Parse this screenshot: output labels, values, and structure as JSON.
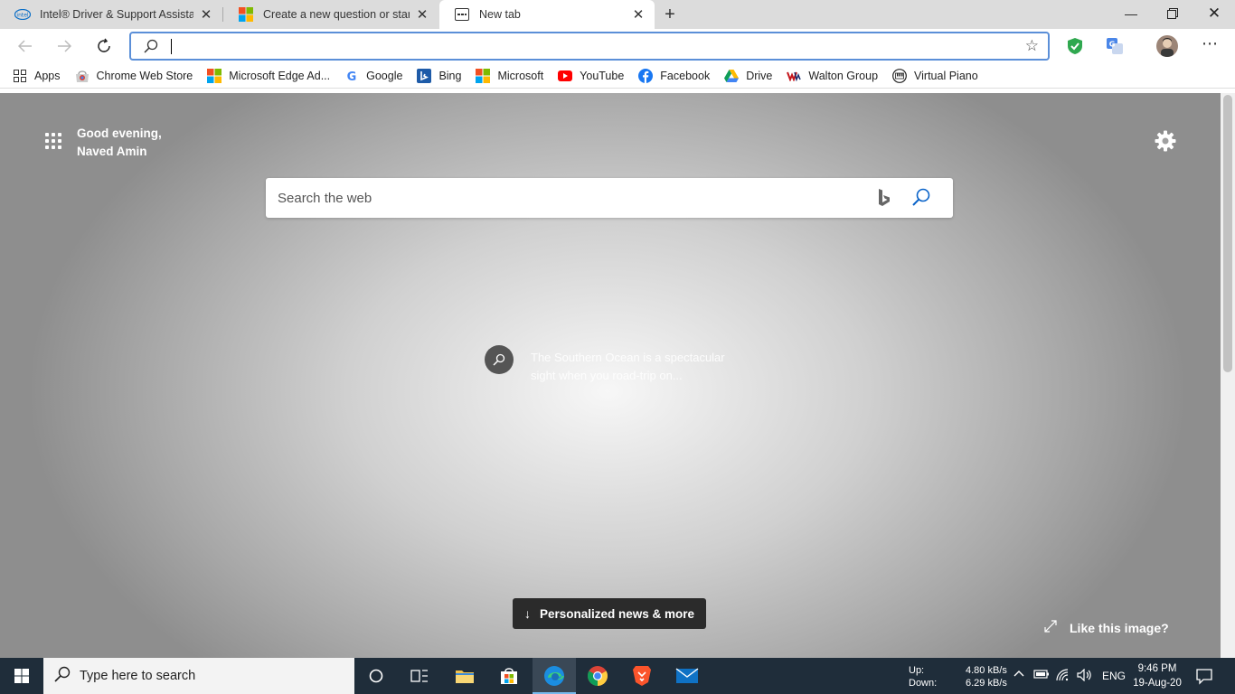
{
  "tabs": [
    {
      "title": "Intel® Driver & Support Assistant",
      "icon": "intel-icon",
      "active": false
    },
    {
      "title": "Create a new question or start a discussion",
      "icon": "microsoft-icon",
      "active": false
    },
    {
      "title": "New tab",
      "icon": "new-tab-icon",
      "active": true
    }
  ],
  "address_bar": {
    "value": "",
    "placeholder": ""
  },
  "bookmarks": [
    {
      "label": "Apps",
      "icon": "apps-grid-icon"
    },
    {
      "label": "Chrome Web Store",
      "icon": "chrome-web-store-icon"
    },
    {
      "label": "Microsoft Edge Ad...",
      "icon": "microsoft-icon"
    },
    {
      "label": "Google",
      "icon": "google-icon"
    },
    {
      "label": "Bing",
      "icon": "bing-icon"
    },
    {
      "label": "Microsoft",
      "icon": "microsoft-icon"
    },
    {
      "label": "YouTube",
      "icon": "youtube-icon"
    },
    {
      "label": "Facebook",
      "icon": "facebook-icon"
    },
    {
      "label": "Drive",
      "icon": "google-drive-icon"
    },
    {
      "label": "Walton Group",
      "icon": "walton-icon"
    },
    {
      "label": "Virtual Piano",
      "icon": "virtual-piano-icon"
    }
  ],
  "newtab": {
    "greeting_line1": "Good evening,",
    "greeting_line2": "Naved Amin",
    "search_placeholder": "Search the web",
    "image_caption": "The Southern Ocean is a spectacular sight when you road-trip on...",
    "news_button": "Personalized news & more",
    "like_image": "Like this image?"
  },
  "taskbar": {
    "search_placeholder": "Type here to search",
    "net_up_label": "Up:",
    "net_down_label": "Down:",
    "net_up_value": "4.80 kB/s",
    "net_down_value": "6.29 kB/s",
    "language": "ENG",
    "time": "9:46 PM",
    "date": "19-Aug-20"
  },
  "colors": {
    "accent": "#5b8fd8",
    "taskbar": "#1f2d3a",
    "tabstrip": "#dcdcdc"
  }
}
